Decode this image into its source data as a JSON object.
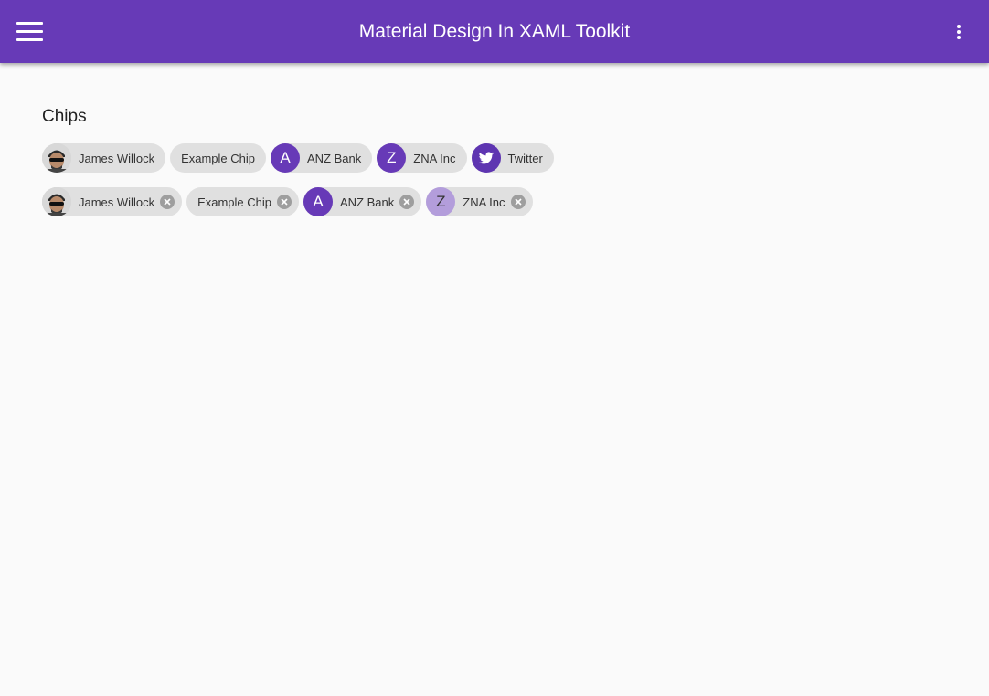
{
  "app": {
    "title": "Material Design In XAML Toolkit",
    "menu_icon": "hamburger-menu-icon",
    "more_icon": "more-vert-icon",
    "brand_color": "#673ab7"
  },
  "section": {
    "title": "Chips"
  },
  "row1": [
    {
      "label": "James Willock",
      "icon": "avatar-photo-icon"
    },
    {
      "label": "Example Chip"
    },
    {
      "label": "ANZ Bank",
      "letter": "A",
      "icon_color": "#673ab7"
    },
    {
      "label": "ZNA Inc",
      "letter": "Z",
      "icon_color": "#673ab7"
    },
    {
      "label": "Twitter",
      "icon": "twitter-bird-icon",
      "icon_color": "#5e35b1"
    }
  ],
  "row2": [
    {
      "label": "James Willock",
      "icon": "avatar-photo-icon",
      "close_icon": "close-circle-icon"
    },
    {
      "label": "Example Chip",
      "close_icon": "close-circle-icon"
    },
    {
      "label": "ANZ Bank",
      "letter": "A",
      "icon_color": "#673ab7",
      "close_icon": "close-circle-icon"
    },
    {
      "label": "ZNA Inc",
      "letter": "Z",
      "icon_color": "#b39ddb",
      "close_icon": "close-circle-icon"
    }
  ]
}
